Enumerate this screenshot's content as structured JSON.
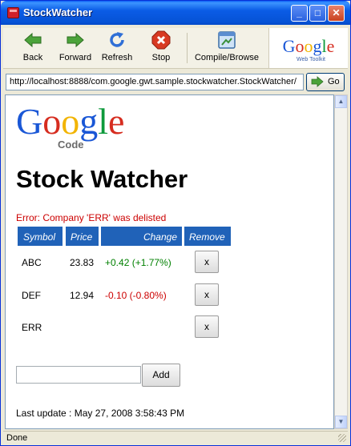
{
  "window": {
    "title": "StockWatcher"
  },
  "title_buttons": {
    "minimize": "_",
    "maximize": "□",
    "close": "✕"
  },
  "toolbar": {
    "back": {
      "label": "Back",
      "icon": "back-arrow-icon",
      "color": "#4BA33A"
    },
    "forward": {
      "label": "Forward",
      "icon": "forward-arrow-icon",
      "color": "#4BA33A"
    },
    "refresh": {
      "label": "Refresh",
      "icon": "refresh-icon",
      "color": "#2F6FD6"
    },
    "stop": {
      "label": "Stop",
      "icon": "stop-icon",
      "color": "#D83A22"
    },
    "compile": {
      "label": "Compile/Browse",
      "icon": "compile-browse-icon"
    },
    "logo": {
      "word": "Google",
      "sub": "Web Toolkit"
    }
  },
  "urlbar": {
    "url": "http://localhost:8888/com.google.gwt.sample.stockwatcher.StockWatcher/",
    "go_label": "Go"
  },
  "page": {
    "logo": {
      "word": "Google",
      "sub": "Code"
    },
    "heading": "Stock Watcher",
    "error": "Error: Company 'ERR' was delisted",
    "table": {
      "headers": {
        "symbol": "Symbol",
        "price": "Price",
        "change": "Change",
        "remove": "Remove"
      },
      "rows": [
        {
          "symbol": "ABC",
          "price": "23.83",
          "change": "+0.42 (+1.77%)",
          "remove": "x"
        },
        {
          "symbol": "DEF",
          "price": "12.94",
          "change": "-0.10 (-0.80%)",
          "remove": "x"
        },
        {
          "symbol": "ERR",
          "price": "",
          "change": "",
          "remove": "x"
        }
      ]
    },
    "new_symbol_value": "",
    "add_label": "Add",
    "last_update": "Last update : May 27, 2008 3:58:43 PM"
  },
  "status": {
    "text": "Done"
  },
  "colors": {
    "header_bg": "#2062B8",
    "positive": "#008000",
    "negative": "#CC0000",
    "titlebar": "#0653D6"
  }
}
